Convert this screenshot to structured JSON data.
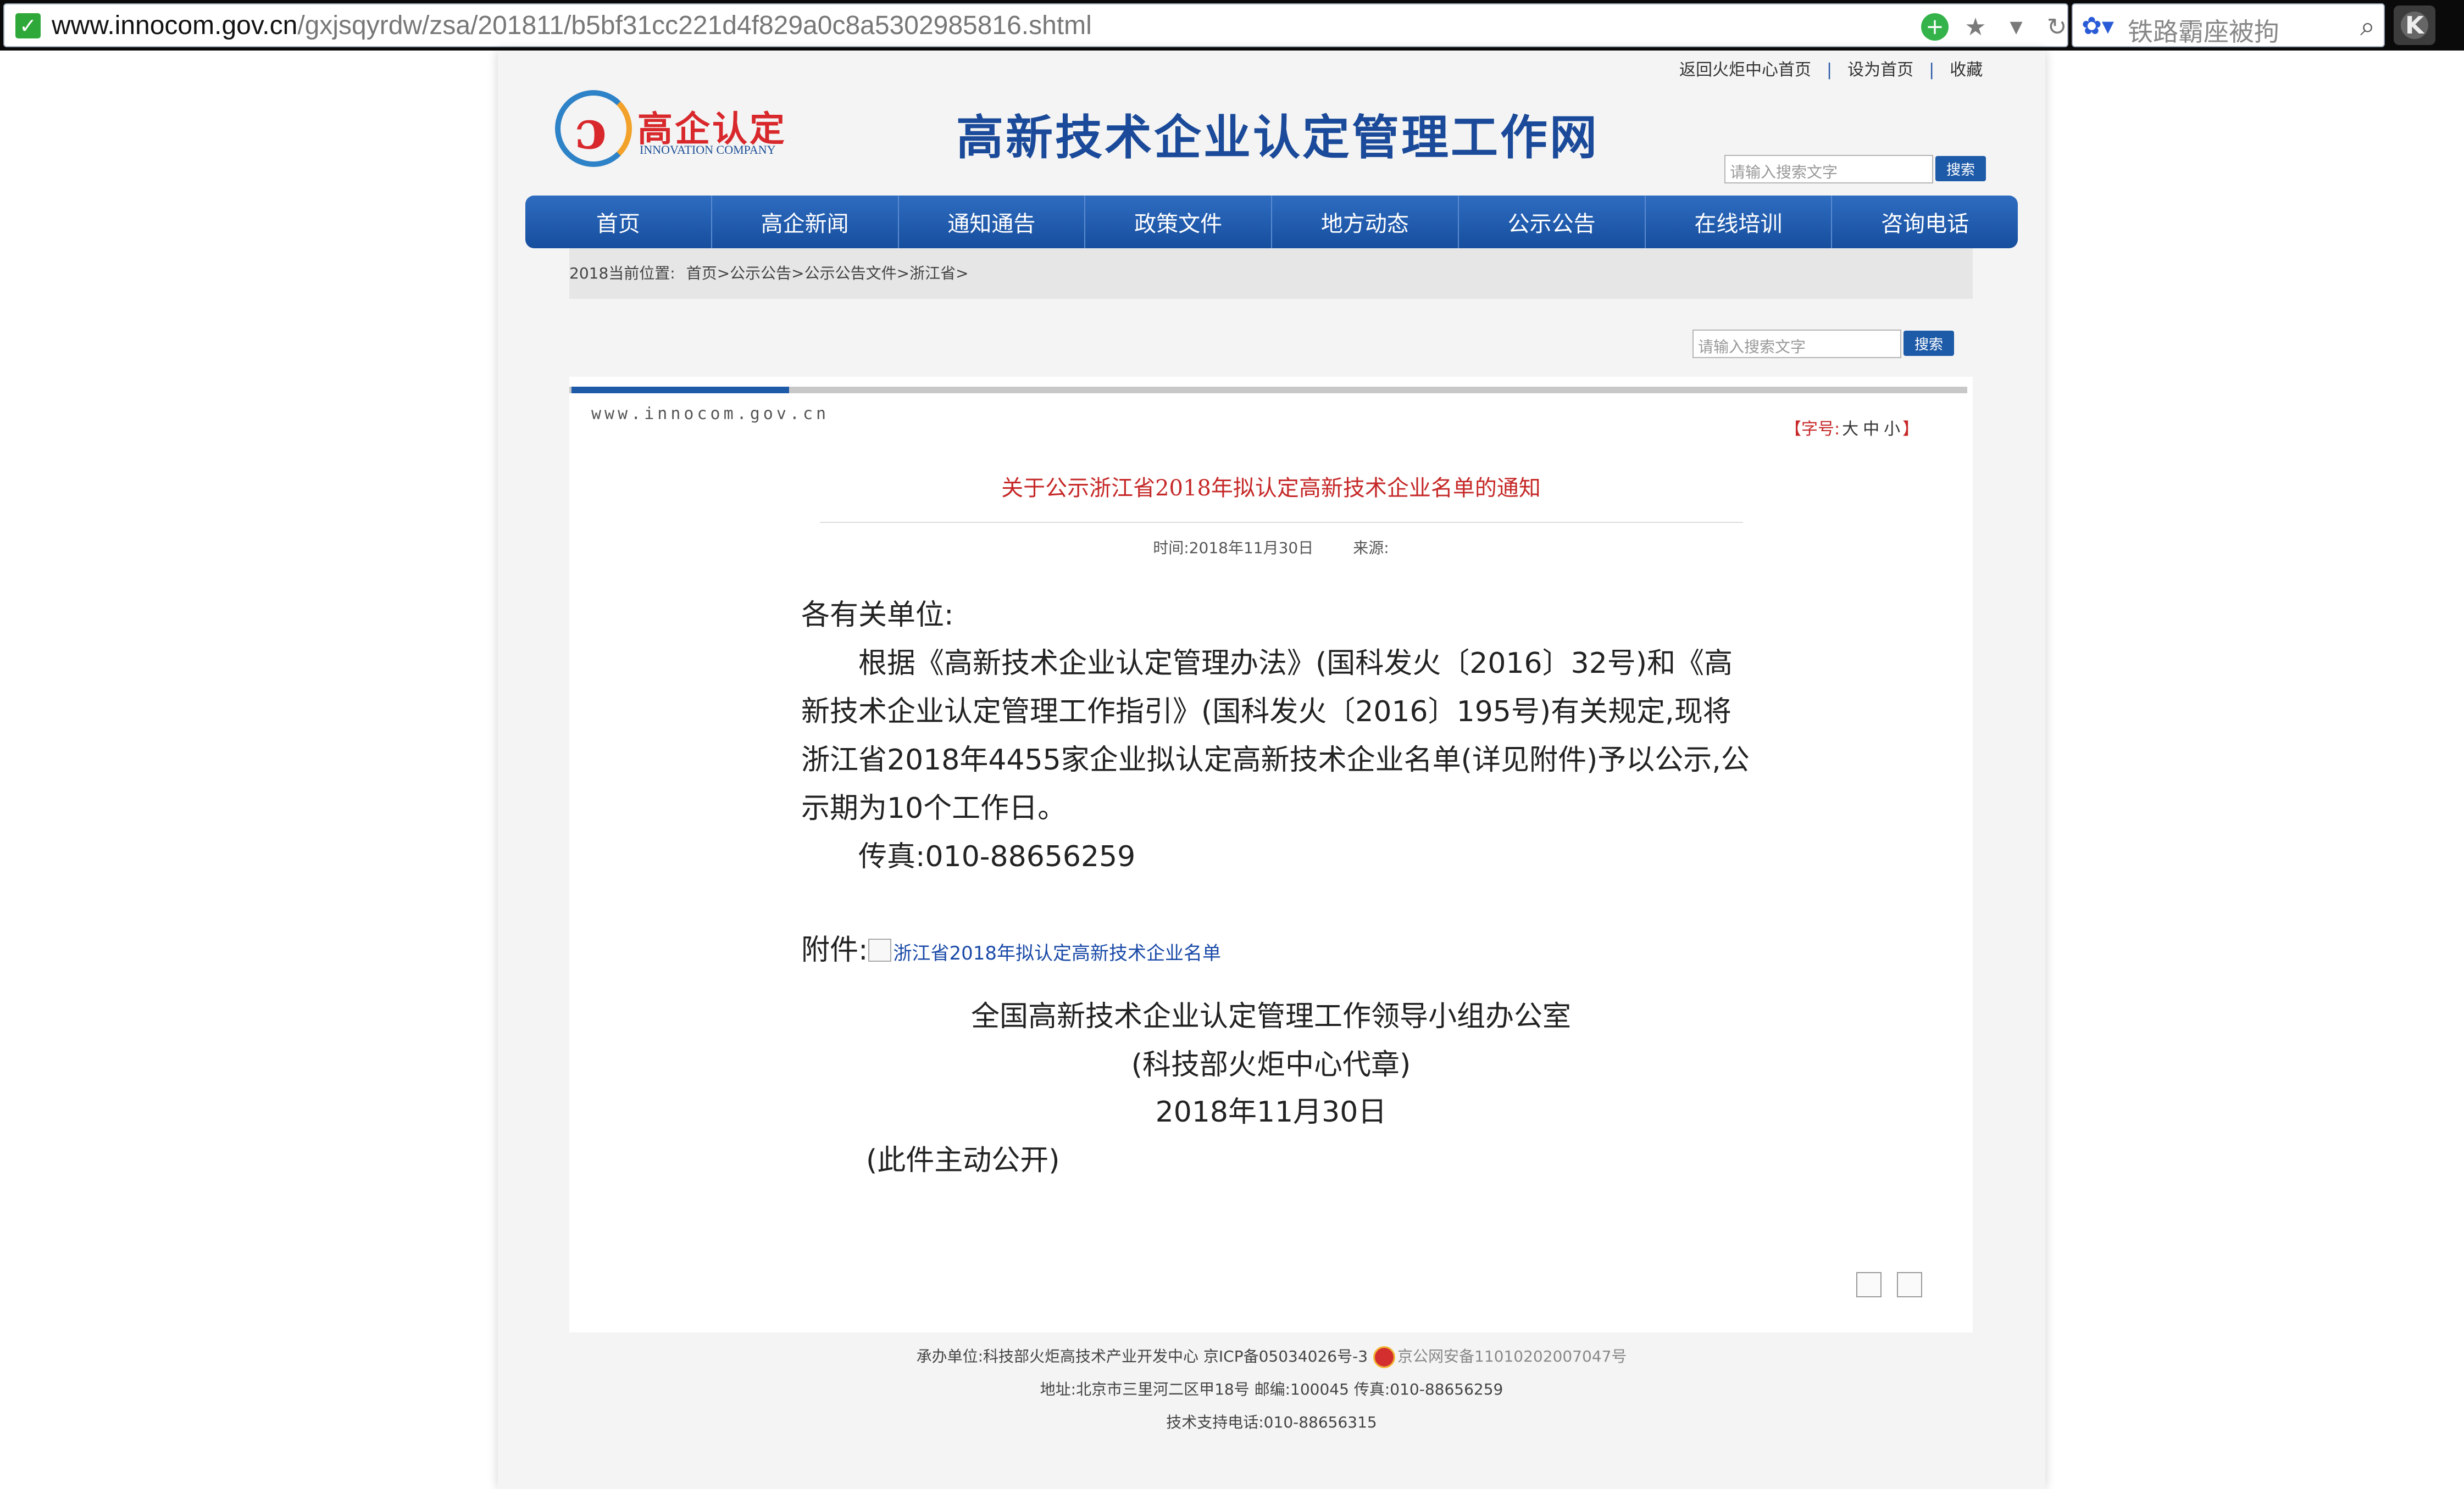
{
  "browser": {
    "url_host": "www.innocom.gov.cn",
    "url_path": "/gxjsqyrdw/zsa/201811/b5bf31cc221d4f829a0c8a5302985816.shtml",
    "search_text": "铁路霸座被拘",
    "icons": [
      "secure-check-icon",
      "add-extension-icon",
      "star-icon",
      "dropdown-icon",
      "reload-icon",
      "paw-search-icon",
      "search-icon",
      "k-extension-icon"
    ],
    "k_label": "K"
  },
  "site": {
    "top_links": [
      "返回火炬中心首页",
      "设为首页",
      "收藏"
    ],
    "logo_name": "高企认定",
    "logo_sub": "INNOVATION COMPANY",
    "title": "高新技术企业认定管理工作网",
    "search_placeholder": "请输入搜索文字",
    "search_button": "搜索"
  },
  "nav": [
    "首页",
    "高企新闻",
    "通知通告",
    "政策文件",
    "地方动态",
    "公示公告",
    "在线培训",
    "咨询电话"
  ],
  "breadcrumb": {
    "label": "2018当前位置:",
    "path": "首页>公示公告>公示公告文件>浙江省>"
  },
  "article": {
    "site_url": "www.innocom.gov.cn",
    "font_size": {
      "prefix": "【字号:",
      "large": "大",
      "medium": "中",
      "small": "小",
      "suffix": "】"
    },
    "title": "关于公示浙江省2018年拟认定高新技术企业名单的通知",
    "time": "时间:2018年11月30日",
    "source": "来源:",
    "salutation": "各有关单位:",
    "paragraph": "根据《高新技术企业认定管理办法》(国科发火〔2016〕32号)和《高新技术企业认定管理工作指引》(国科发火〔2016〕195号)有关规定,现将浙江省2018年4455家企业拟认定高新技术企业名单(详见附件)予以公示,公示期为10个工作日。",
    "fax": "传真:010-88656259",
    "attachment_label": "附件:",
    "attachment_link": "浙江省2018年拟认定高新技术企业名单",
    "signature_org": "全国高新技术企业认定管理工作领导小组办公室",
    "signature_seal": "(科技部火炬中心代章)",
    "signature_date": "2018年11月30日",
    "public_note": "(此件主动公开)"
  },
  "footer": {
    "line1": "承办单位:科技部火炬高技术产业开发中心 京ICP备05034026号-3",
    "police": "京公网安备11010202007047号",
    "line2": "地址:北京市三里河二区甲18号 邮编:100045 传真:010-88656259",
    "line3": "技术支持电话:010-88656315"
  }
}
